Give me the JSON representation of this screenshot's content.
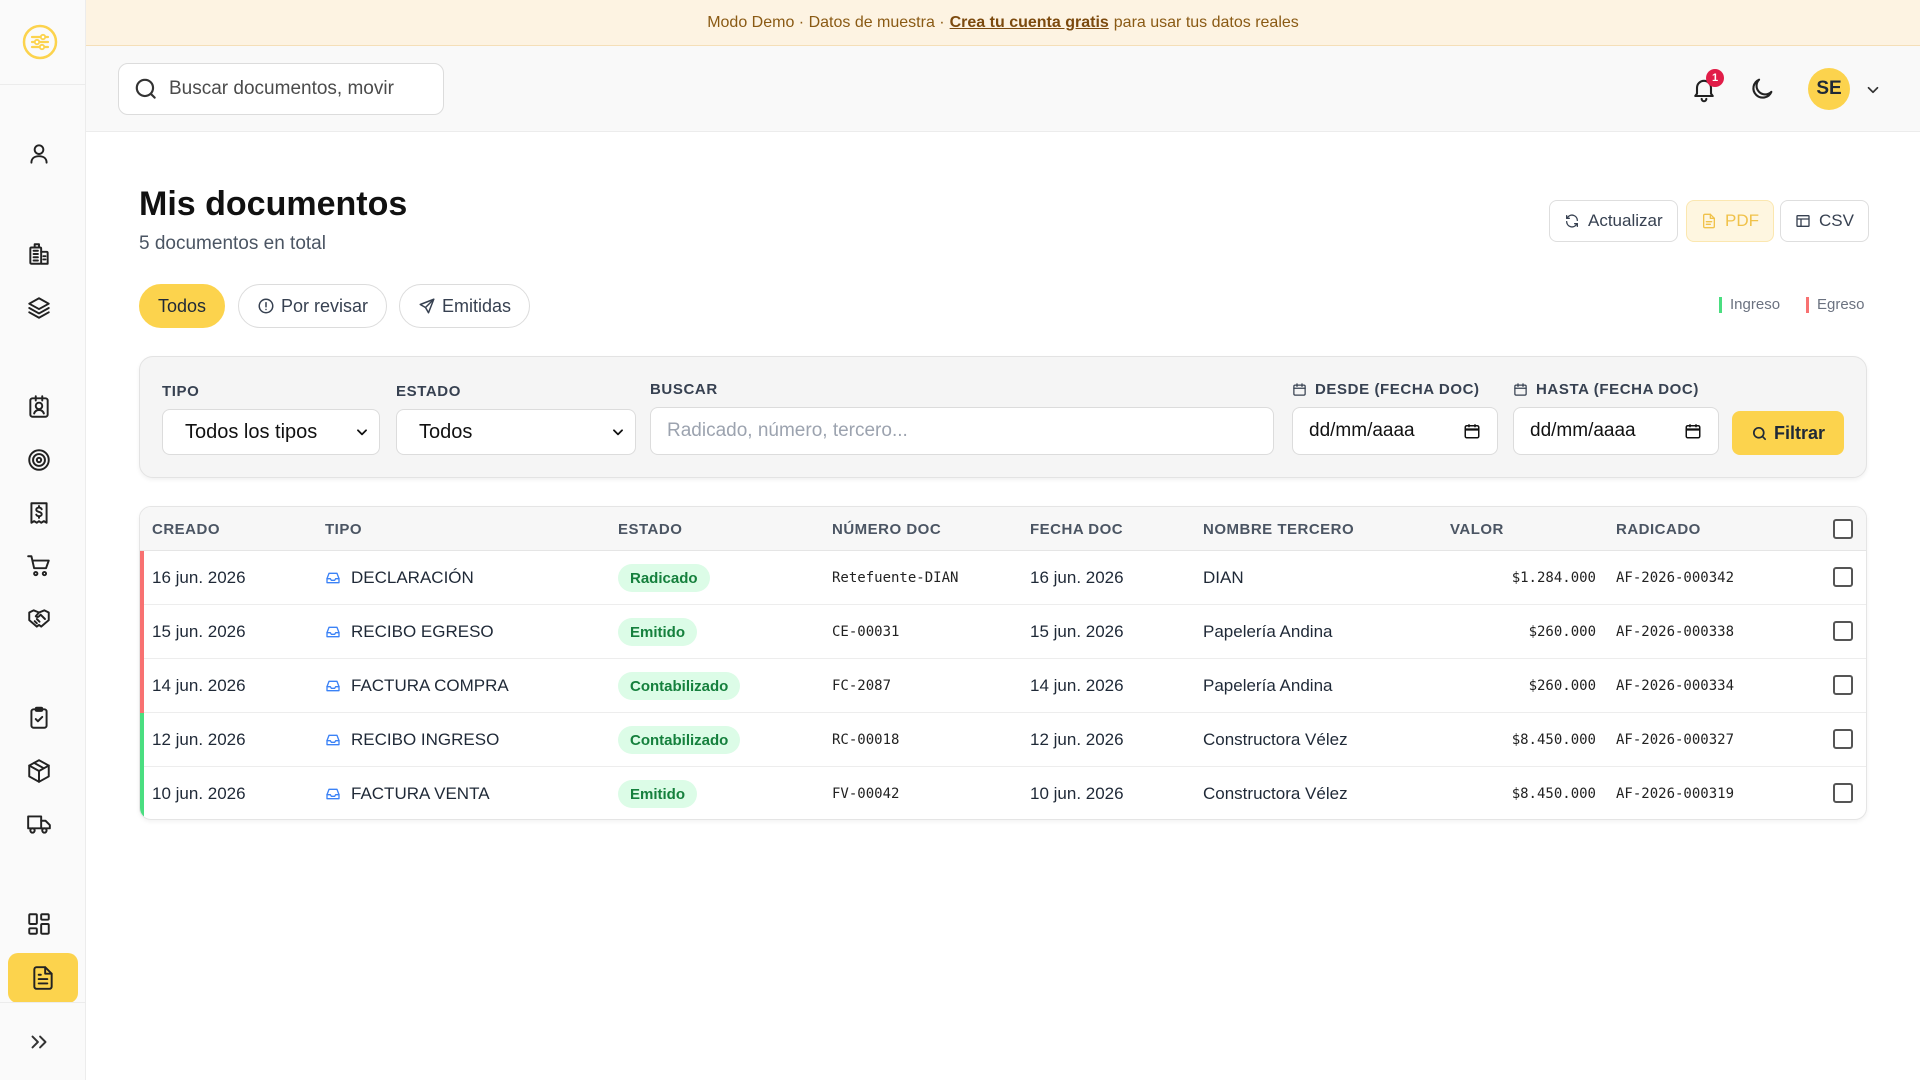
{
  "banner": {
    "prefix": "Modo Demo · Datos de muestra ·",
    "link": "Crea tu cuenta gratis",
    "suffix": "para usar tus datos reales"
  },
  "header": {
    "search_placeholder": "Buscar documentos, movir",
    "notification_count": "1",
    "avatar_initials": "SE"
  },
  "page": {
    "title": "Mis documentos",
    "subtitle": "5 documentos en total"
  },
  "actions": {
    "refresh": "Actualizar",
    "pdf": "PDF",
    "csv": "CSV"
  },
  "tabs": [
    {
      "label": "Todos",
      "active": true
    },
    {
      "label": "Por revisar",
      "active": false
    },
    {
      "label": "Emitidas",
      "active": false
    }
  ],
  "legend": {
    "income": "Ingreso",
    "expense": "Egreso",
    "income_color": "#4ade80",
    "expense_color": "#f87171"
  },
  "filters": {
    "type_label": "TIPO",
    "type_value": "Todos los tipos",
    "status_label": "ESTADO",
    "status_value": "Todos",
    "search_label": "BUSCAR",
    "search_placeholder": "Radicado, número, tercero...",
    "from_label": "DESDE (FECHA DOC)",
    "from_value": "dd/mm/aaaa",
    "to_label": "HASTA (FECHA DOC)",
    "to_value": "dd/mm/aaaa",
    "filter_button": "Filtrar"
  },
  "table": {
    "headers": {
      "created": "CREADO",
      "type": "TIPO",
      "status": "ESTADO",
      "doc_number": "NÚMERO DOC",
      "doc_date": "FECHA DOC",
      "third_party": "NOMBRE TERCERO",
      "value": "VALOR",
      "filed": "RADICADO"
    },
    "rows": [
      {
        "created": "16 jun. 2026",
        "type": "DECLARACIÓN",
        "status": "Radicado",
        "doc_number": "Retefuente-DIAN",
        "doc_date": "16 jun. 2026",
        "third_party": "DIAN",
        "value": "$1.284.000",
        "filed": "AF-2026-000342",
        "flow": "expense"
      },
      {
        "created": "15 jun. 2026",
        "type": "RECIBO EGRESO",
        "status": "Emitido",
        "doc_number": "CE-00031",
        "doc_date": "15 jun. 2026",
        "third_party": "Papelería Andina",
        "value": "$260.000",
        "filed": "AF-2026-000338",
        "flow": "expense"
      },
      {
        "created": "14 jun. 2026",
        "type": "FACTURA COMPRA",
        "status": "Contabilizado",
        "doc_number": "FC-2087",
        "doc_date": "14 jun. 2026",
        "third_party": "Papelería Andina",
        "value": "$260.000",
        "filed": "AF-2026-000334",
        "flow": "expense"
      },
      {
        "created": "12 jun. 2026",
        "type": "RECIBO INGRESO",
        "status": "Contabilizado",
        "doc_number": "RC-00018",
        "doc_date": "12 jun. 2026",
        "third_party": "Constructora Vélez",
        "value": "$8.450.000",
        "filed": "AF-2026-000327",
        "flow": "income"
      },
      {
        "created": "10 jun. 2026",
        "type": "FACTURA VENTA",
        "status": "Emitido",
        "doc_number": "FV-00042",
        "doc_date": "10 jun. 2026",
        "third_party": "Constructora Vélez",
        "value": "$8.450.000",
        "filed": "AF-2026-000319",
        "flow": "income"
      }
    ]
  },
  "colors": {
    "accent": "#fcd34d",
    "status_bg": "#dcfce7",
    "status_text": "#15803d"
  },
  "sidebar_icons": [
    "user-icon",
    "building-icon",
    "layers-icon",
    "contacts-icon",
    "target-icon",
    "invoice-dollar-icon",
    "cart-icon",
    "handshake-icon",
    "clipboard-check-icon",
    "package-icon",
    "truck-icon",
    "dashboard-icon",
    "document-icon",
    "expand-icon"
  ]
}
